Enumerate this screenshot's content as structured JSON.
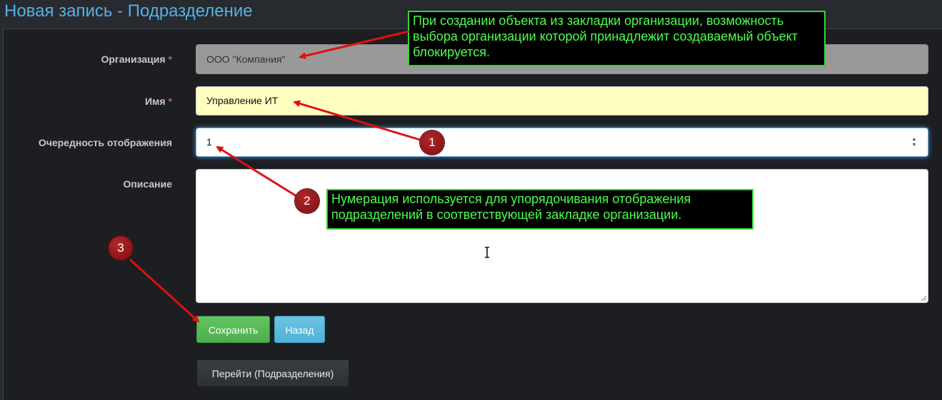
{
  "page": {
    "title": "Новая запись - Подразделение"
  },
  "form": {
    "organization": {
      "label": "Организация",
      "required_mark": "*",
      "value": "ООО \"Компания\""
    },
    "name": {
      "label": "Имя",
      "required_mark": "*",
      "value": "Управление ИТ"
    },
    "order": {
      "label": "Очередность отображения",
      "value": "1",
      "spinner_up": "▲",
      "spinner_down": "▼"
    },
    "description": {
      "label": "Описание",
      "value": ""
    }
  },
  "buttons": {
    "save": "Сохранить",
    "back": "Назад",
    "goto": "Перейти (Подразделения)"
  },
  "annotations": {
    "note1": "При создании объекта из закладки организации, возможность выбора организации которой принадлежит создаваемый объект блокируется.",
    "note2": "Нумерация используется для упорядочивания отображения подразделений в соответствующей закладке организации.",
    "badge1": "1",
    "badge2": "2",
    "badge3": "3"
  },
  "colors": {
    "title": "#55b0e6",
    "required": "#d9534f",
    "save_button": "#5cb85c",
    "back_button": "#5bc0de",
    "note_text": "#4cff4c",
    "arrow": "#e01010"
  }
}
